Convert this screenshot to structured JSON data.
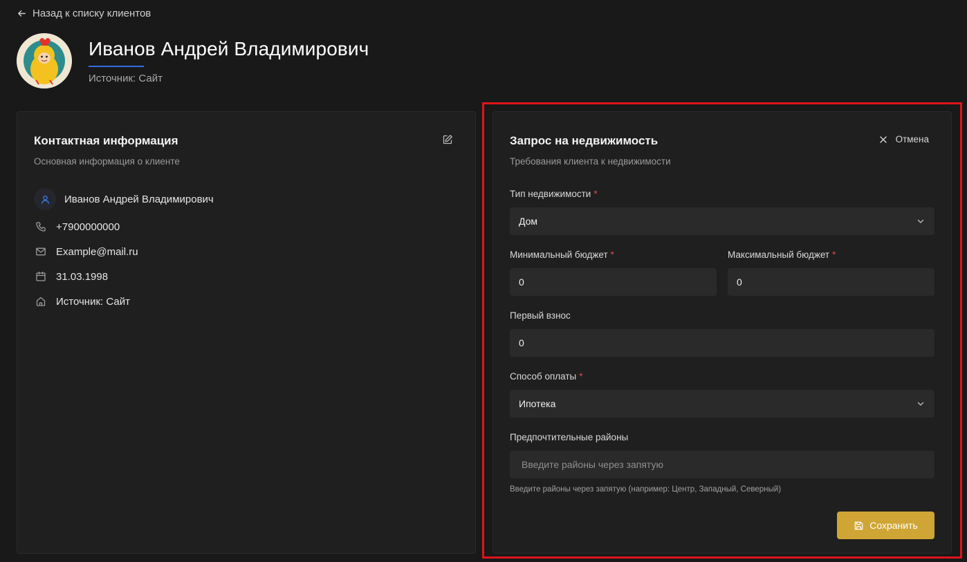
{
  "header": {
    "back_label": "Назад к списку клиентов",
    "client_name": "Иванов Андрей Владимирович",
    "source": "Источник: Сайт"
  },
  "contact_card": {
    "title": "Контактная информация",
    "subtitle": "Основная информация о клиенте",
    "rows": [
      {
        "icon": "user-icon",
        "value": "Иванов Андрей Владимирович"
      },
      {
        "icon": "phone-icon",
        "value": "+7900000000"
      },
      {
        "icon": "mail-icon",
        "value": "Example@mail.ru"
      },
      {
        "icon": "calendar-icon",
        "value": "31.03.1998"
      },
      {
        "icon": "home-icon",
        "value": "Источник: Сайт"
      }
    ]
  },
  "request_card": {
    "title": "Запрос на недвижимость",
    "subtitle": "Требования клиента к недвижимости",
    "cancel_label": "Отмена",
    "property_type": {
      "label": "Тип недвижимости",
      "required_mark": "*",
      "value": "Дом"
    },
    "min_budget": {
      "label": "Минимальный бюджет",
      "required_mark": "*",
      "value": "0"
    },
    "max_budget": {
      "label": "Максимальный бюджет",
      "required_mark": "*",
      "value": "0"
    },
    "down_payment": {
      "label": "Первый взнос",
      "value": "0"
    },
    "payment_method": {
      "label": "Способ оплаты",
      "required_mark": "*",
      "value": "Ипотека"
    },
    "districts": {
      "label": "Предпочтительные районы",
      "placeholder": "Введите районы через запятую",
      "hint": "Введите районы через запятую (например: Центр, Западный, Северный)"
    },
    "save_label": "Сохранить"
  },
  "colors": {
    "background": "#191919",
    "card": "#1f1f1f",
    "accent_blue": "#2f6fe4",
    "save_button": "#cfa535",
    "highlight": "#e0141b",
    "required": "#e5484d"
  }
}
